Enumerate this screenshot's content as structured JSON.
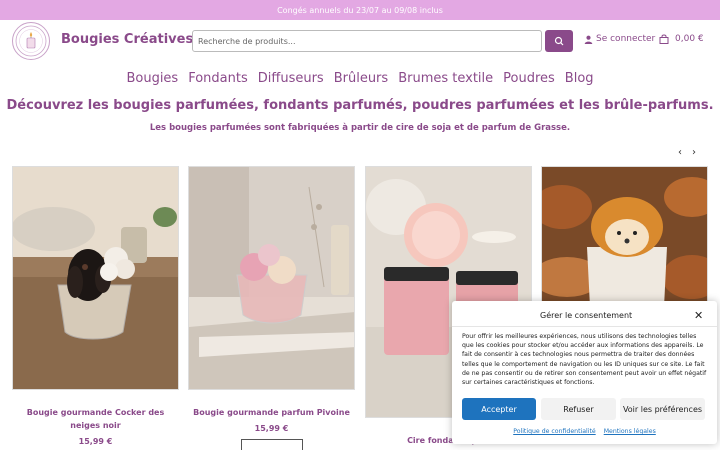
{
  "announcement": "Congés annuels du 23/07 au 09/08 inclus",
  "header": {
    "brand": "Bougies Créatives",
    "search_placeholder": "Recherche de produits...",
    "account_label": "Se connecter",
    "cart_amount": "0,00 €"
  },
  "nav": [
    "Bougies",
    "Fondants",
    "Diffuseurs",
    "Brûleurs",
    "Brumes textile",
    "Poudres",
    "Blog"
  ],
  "headline": "Découvrez les bougies parfumées, fondants parfumés, poudres parfumées et les brûle-parfums.",
  "subline": "Les bougies parfumées sont fabriquées à partir de cire de soja et de parfum de Grasse.",
  "products": [
    {
      "title": "Bougie gourmande Cocker des neiges noir",
      "price": "15,99 €"
    },
    {
      "title": "Bougie gourmande parfum Pivoine",
      "price": "15,99 €"
    },
    {
      "title": "Cire fondante parf",
      "price": ""
    },
    {
      "title": "",
      "price": ""
    }
  ],
  "consent": {
    "title": "Gérer le consentement",
    "text": "Pour offrir les meilleures expériences, nous utilisons des technologies telles que les cookies pour stocker et/ou accéder aux informations des appareils. Le fait de consentir à ces technologies nous permettra de traiter des données telles que le comportement de navigation ou les ID uniques sur ce site. Le fait de ne pas consentir ou de retirer son consentement peut avoir un effet négatif sur certaines caractéristiques et fonctions.",
    "accept": "Accepter",
    "refuse": "Refuser",
    "preferences": "Voir les préférences",
    "privacy_link": "Politique de confidentialité",
    "legal_link": "Mentions légales"
  },
  "colors": {
    "accent": "#8a4a8a",
    "topbar": "#e3a8e3",
    "consent_button": "#1e73be"
  }
}
